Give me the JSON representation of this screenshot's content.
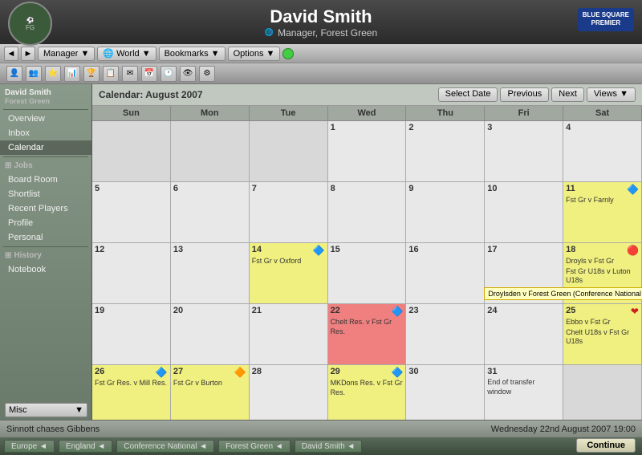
{
  "header": {
    "name": "David Smith",
    "subtitle": "Manager, Forest Green",
    "club": "Forest Green",
    "sponsor": "BLUE SQUARE\nPREMIER"
  },
  "nav": {
    "back_label": "◄",
    "forward_label": "►",
    "manager_label": "Manager ▼",
    "world_label": "🌐 World ▼",
    "bookmarks_label": "Bookmarks ▼",
    "options_label": "Options ▼"
  },
  "sidebar": {
    "profile_text": "David Smith\nForest Green",
    "items": [
      {
        "label": "Overview",
        "active": false
      },
      {
        "label": "Inbox",
        "active": false
      },
      {
        "label": "Calendar",
        "active": true
      },
      {
        "label": "Jobs",
        "active": false,
        "section": true
      },
      {
        "label": "Board Room",
        "active": false
      },
      {
        "label": "Shortlist",
        "active": false
      },
      {
        "label": "Recent Players",
        "active": false
      },
      {
        "label": "Profile",
        "active": false
      },
      {
        "label": "Personal",
        "active": false
      },
      {
        "label": "History",
        "active": false,
        "section": true
      },
      {
        "label": "Notebook",
        "active": false
      }
    ],
    "misc_label": "Misc",
    "misc_arrow": "▼"
  },
  "calendar": {
    "title": "Calendar: August 2007",
    "select_date_label": "Select Date",
    "prev_label": "Previous",
    "next_label": "Next",
    "views_label": "Views ▼",
    "day_headers": [
      "Sun",
      "Mon",
      "Tue",
      "Wed",
      "Thu",
      "Fri",
      "Sat"
    ],
    "weeks": [
      [
        {
          "date": "",
          "events": [],
          "style": "empty"
        },
        {
          "date": "",
          "events": [],
          "style": "empty"
        },
        {
          "date": "",
          "events": [],
          "style": "empty"
        },
        {
          "date": "1",
          "events": [],
          "style": "normal"
        },
        {
          "date": "2",
          "events": [],
          "style": "normal"
        },
        {
          "date": "3",
          "events": [],
          "style": "normal"
        },
        {
          "date": "4",
          "events": [],
          "style": "normal"
        }
      ],
      [
        {
          "date": "5",
          "events": [],
          "style": "normal"
        },
        {
          "date": "6",
          "events": [],
          "style": "normal"
        },
        {
          "date": "7",
          "events": [],
          "style": "normal"
        },
        {
          "date": "8",
          "events": [],
          "style": "normal"
        },
        {
          "date": "9",
          "events": [],
          "style": "normal"
        },
        {
          "date": "10",
          "events": [],
          "style": "normal"
        },
        {
          "date": "11",
          "events": [
            "Fst Gr v Farnly"
          ],
          "style": "yellow",
          "icon": "blue"
        }
      ],
      [
        {
          "date": "12",
          "events": [],
          "style": "normal"
        },
        {
          "date": "13",
          "events": [],
          "style": "normal"
        },
        {
          "date": "14",
          "events": [
            "Fst Gr v Oxford"
          ],
          "style": "yellow",
          "icon": "blue"
        },
        {
          "date": "15",
          "events": [],
          "style": "normal"
        },
        {
          "date": "16",
          "events": [],
          "style": "normal"
        },
        {
          "date": "17",
          "events": [],
          "style": "normal"
        },
        {
          "date": "18",
          "events": [
            "Droyls v Fst Gr",
            "Fst Gr U18s v Luton U18s",
            "Droylsden v Forest Green (Conference National"
          ],
          "style": "yellow",
          "icon": "red",
          "tooltip": "Droylsden v Forest Green (Conference National"
        }
      ],
      [
        {
          "date": "19",
          "events": [],
          "style": "normal"
        },
        {
          "date": "20",
          "events": [],
          "style": "normal"
        },
        {
          "date": "21",
          "events": [],
          "style": "normal"
        },
        {
          "date": "22",
          "events": [
            "Chelt Res. v Fst Gr Res."
          ],
          "style": "red",
          "icon": "blue"
        },
        {
          "date": "23",
          "events": [],
          "style": "normal"
        },
        {
          "date": "24",
          "events": [],
          "style": "normal"
        },
        {
          "date": "25",
          "events": [
            "Ebbo v Fst Gr",
            "Chelt U18s v Fst Gr U18s"
          ],
          "style": "yellow",
          "icon": "red"
        }
      ],
      [
        {
          "date": "26",
          "events": [
            "Fst Gr Res. v Mill Res."
          ],
          "style": "yellow",
          "icon": "blue"
        },
        {
          "date": "27",
          "events": [
            "Fst Gr v Burton"
          ],
          "style": "yellow",
          "icon": "yellow"
        },
        {
          "date": "28",
          "events": [],
          "style": "normal"
        },
        {
          "date": "29",
          "events": [
            "MKDons Res. v Fst Gr Res."
          ],
          "style": "yellow",
          "icon": "blue"
        },
        {
          "date": "30",
          "events": [],
          "style": "normal"
        },
        {
          "date": "31",
          "events": [
            "End of transfer window"
          ],
          "style": "normal"
        },
        {
          "date": "",
          "events": [],
          "style": "empty"
        }
      ]
    ]
  },
  "status": {
    "news": "Sinnott chases Gibbens",
    "datetime": "Wednesday 22nd August 2007 19:00"
  },
  "taskbar": {
    "items": [
      "Europe ◄",
      "England ◄",
      "Conference National ◄",
      "Forest Green ◄",
      "David Smith ◄"
    ]
  },
  "continue_label": "Continue"
}
